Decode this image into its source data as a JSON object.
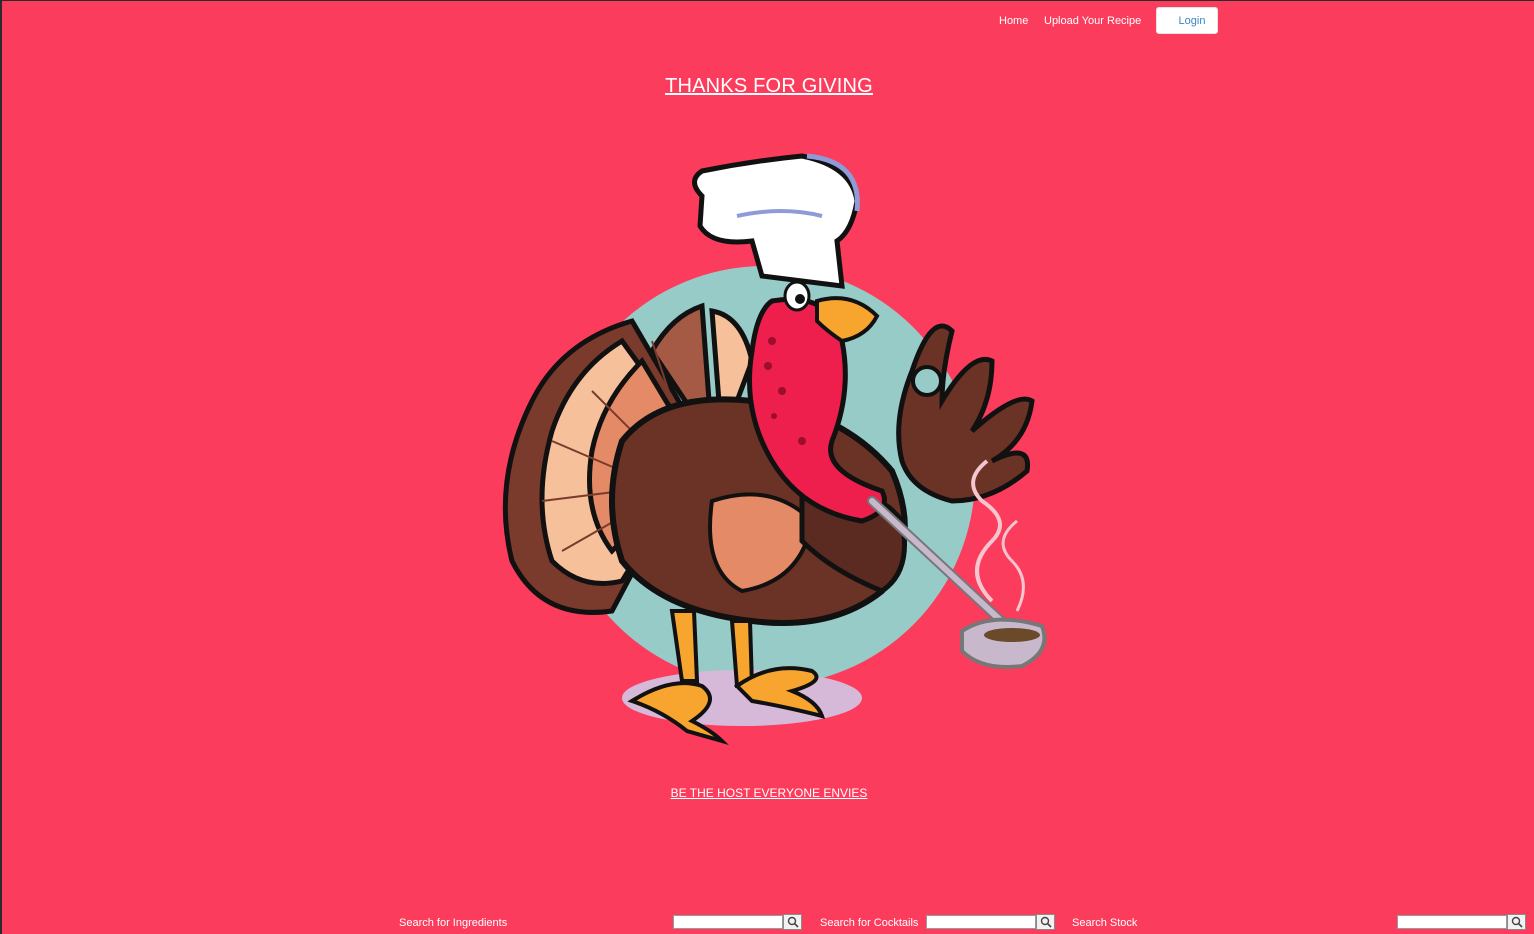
{
  "nav": {
    "home_label": "Home",
    "upload_label": "Upload Your Recipe",
    "login_label": "Login"
  },
  "page": {
    "title": "THANKS FOR GIVING",
    "tagline": "BE THE HOST EVERYONE ENVIES"
  },
  "hero": {
    "image": "chef-turkey-illustration"
  },
  "search": {
    "ingredients_label": "Search for Ingredients",
    "cocktails_label": "Search for Cocktails",
    "stock_label": "Search Stock",
    "ingredients_value": "",
    "cocktails_value": "",
    "stock_value": "",
    "button_icon": "search-icon"
  },
  "colors": {
    "background": "#fc3c5c",
    "circle": "#97cbc8",
    "login_text": "#3a86c4"
  }
}
